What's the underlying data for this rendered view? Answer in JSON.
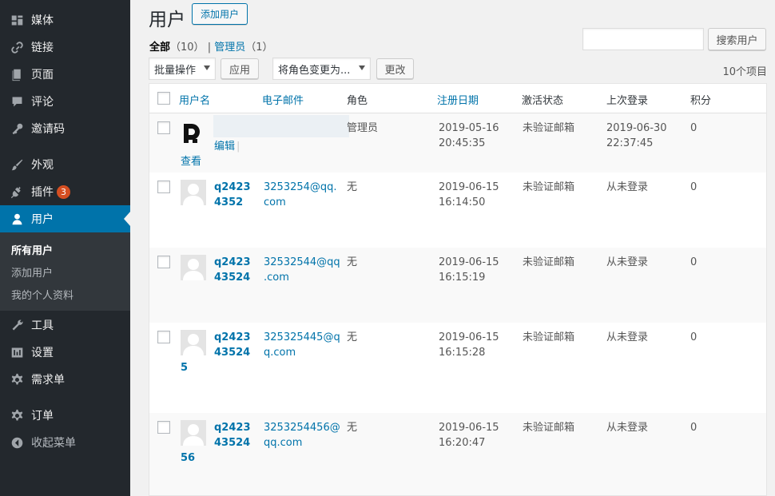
{
  "sidebar": {
    "items": [
      {
        "label": "媒体",
        "icon": "media-icon"
      },
      {
        "label": "链接",
        "icon": "link-icon"
      },
      {
        "label": "页面",
        "icon": "page-icon"
      },
      {
        "label": "评论",
        "icon": "comment-icon"
      },
      {
        "label": "邀请码",
        "icon": "key-icon"
      },
      {
        "label": "外观",
        "icon": "brush-icon"
      },
      {
        "label": "插件",
        "icon": "plugin-icon",
        "badge": "3"
      },
      {
        "label": "用户",
        "icon": "user-icon"
      },
      {
        "label": "工具",
        "icon": "wrench-icon"
      },
      {
        "label": "设置",
        "icon": "settings-icon"
      },
      {
        "label": "需求单",
        "icon": "gear-icon"
      },
      {
        "label": "订单",
        "icon": "gear-icon"
      },
      {
        "label": "收起菜单",
        "icon": "collapse-icon"
      }
    ],
    "submenu": [
      "所有用户",
      "添加用户",
      "我的个人资料"
    ]
  },
  "header": {
    "title": "用户",
    "add_button": "添加用户"
  },
  "filters": {
    "all_label": "全部",
    "all_count": "（10）",
    "separator": "|",
    "admin_label": "管理员",
    "admin_count": "（1）"
  },
  "search": {
    "button": "搜索用户",
    "value": ""
  },
  "bulk": {
    "select": "批量操作",
    "apply": "应用",
    "role_select": "将角色变更为...",
    "change": "更改"
  },
  "item_count": "10个项目",
  "table": {
    "headers": [
      "用户名",
      "电子邮件",
      "角色",
      "注册日期",
      "激活状态",
      "上次登录",
      "积分"
    ],
    "rows": [
      {
        "username": "",
        "email": "",
        "role": "管理员",
        "reg_date": "2019-05-16",
        "reg_time": "20:45:35",
        "status": "未验证邮箱",
        "last_login_date": "2019-06-30",
        "last_login_time": "22:37:45",
        "points": "0",
        "actions": [
          "编辑",
          "|"
        ],
        "view": "查看"
      },
      {
        "username_lines": [
          "q2423",
          "4352"
        ],
        "email_lines": [
          "3253254@qq.",
          "com"
        ],
        "role": "无",
        "reg_date": "2019-06-15",
        "reg_time": "16:14:50",
        "status": "未验证邮箱",
        "last_login": "从未登录",
        "points": "0"
      },
      {
        "username_lines": [
          "q2423",
          "43524"
        ],
        "email_lines": [
          "32532544@qq",
          ".com"
        ],
        "role": "无",
        "reg_date": "2019-06-15",
        "reg_time": "16:15:19",
        "status": "未验证邮箱",
        "last_login": "从未登录",
        "points": "0"
      },
      {
        "username_lines": [
          "q2423",
          "43524",
          "5"
        ],
        "email_lines": [
          "325325445@q",
          "q.com"
        ],
        "role": "无",
        "reg_date": "2019-06-15",
        "reg_time": "16:15:28",
        "status": "未验证邮箱",
        "last_login": "从未登录",
        "points": "0"
      },
      {
        "username_lines": [
          "q2423",
          "43524",
          "56"
        ],
        "email_lines": [
          "3253254456@",
          "qq.com"
        ],
        "role": "无",
        "reg_date": "2019-06-15",
        "reg_time": "16:20:47",
        "status": "未验证邮箱",
        "last_login": "从未登录",
        "points": "0"
      }
    ]
  },
  "colors": {
    "sidebar_bg": "#23282d",
    "active_bg": "#0073aa",
    "link": "#0073aa",
    "badge": "#d54e21"
  }
}
